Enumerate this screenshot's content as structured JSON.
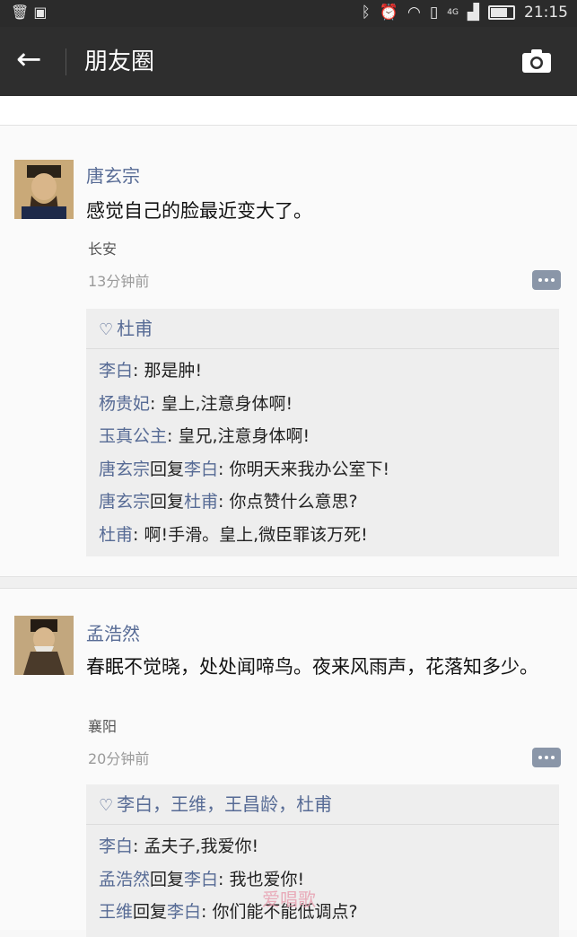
{
  "status_bar": {
    "time": "21:15",
    "network": "4G"
  },
  "header": {
    "title": "朋友圈"
  },
  "posts": [
    {
      "name": "唐玄宗",
      "content": "感觉自己的脸最近变大了。",
      "location": "长安",
      "time": "13分钟前",
      "likes": "杜甫",
      "comments": [
        {
          "who": "李白",
          "text": ": 那是肿!"
        },
        {
          "who": "杨贵妃",
          "text": ": 皇上,注意身体啊!"
        },
        {
          "who": "玉真公主",
          "text": ": 皇兄,注意身体啊!"
        },
        {
          "who": "唐玄宗",
          "mid": "回复",
          "to": "李白",
          "text": ": 你明天来我办公室下!"
        },
        {
          "who": "唐玄宗",
          "mid": "回复",
          "to": "杜甫",
          "text": ": 你点赞什么意思?"
        },
        {
          "who": "杜甫",
          "text": ": 啊!手滑。皇上,微臣罪该万死!"
        }
      ]
    },
    {
      "name": "孟浩然",
      "content": "春眠不觉晓，处处闻啼鸟。夜来风雨声，花落知多少。",
      "location": "襄阳",
      "time": "20分钟前",
      "likes": "李白，王维，王昌龄，杜甫",
      "comments": [
        {
          "who": "李白",
          "text": ": 孟夫子,我爱你!"
        },
        {
          "who": "孟浩然",
          "mid": "回复",
          "to": "李白",
          "text": ": 我也爱你!"
        },
        {
          "who": "王维",
          "mid": "回复",
          "to": "李白",
          "text": ": 你们能不能低调点?"
        }
      ]
    }
  ],
  "watermark": "爱唱歌"
}
